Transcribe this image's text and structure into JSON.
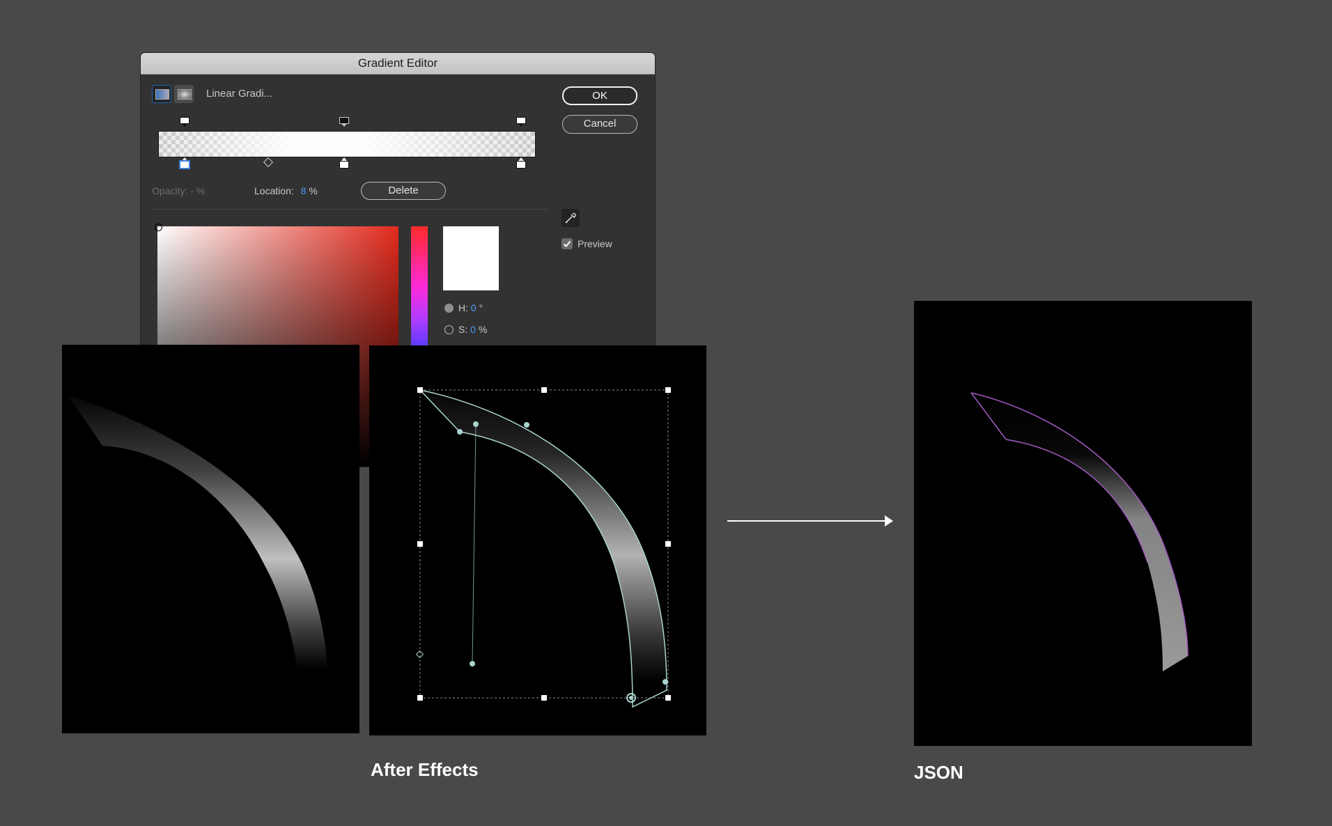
{
  "dialog": {
    "title": "Gradient Editor",
    "type_label": "Linear Gradi...",
    "ok_label": "OK",
    "cancel_label": "Cancel",
    "opacity_label": "Opacity:",
    "opacity_value": "- %",
    "location_label": "Location:",
    "location_value": "8",
    "location_unit": "%",
    "delete_label": "Delete",
    "preview_label": "Preview",
    "preview_checked": true,
    "h_label": "H:",
    "h_value": "0",
    "h_unit": "°",
    "s_label": "S:",
    "s_value": "0",
    "s_unit": "%",
    "selected_color": "#ffffff",
    "accent_color": "#4d9bff"
  },
  "captions": {
    "after_effects": "After Effects",
    "json": "JSON"
  },
  "colors": {
    "background": "#4a4948",
    "path_stroke": "#a9d4cf",
    "json_stroke": "#a35cc4",
    "json_fill": "#9a9a9a"
  }
}
